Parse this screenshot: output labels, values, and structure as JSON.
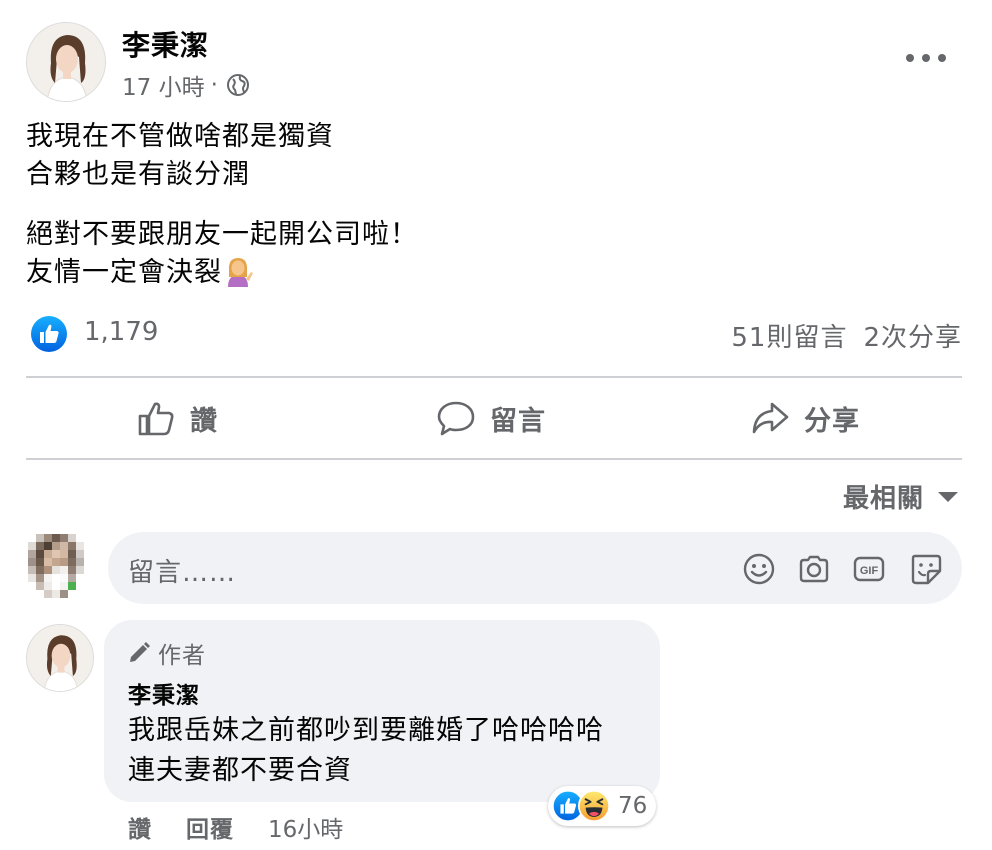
{
  "post": {
    "author": "李秉潔",
    "time": "17 小時",
    "separator": "·",
    "visibility_icon": "globe-icon",
    "paragraphs": [
      [
        "我現在不管做啥都是獨資",
        "合夥也是有談分潤"
      ],
      [
        "絕對不要跟朋友一起開公司啦！",
        "友情一定會決裂"
      ]
    ],
    "emoji": "woman-tipping-hand-emoji"
  },
  "stats": {
    "reaction_icon": "like-badge-icon",
    "likes": "1,179",
    "comments": "51則留言",
    "shares": "2次分享"
  },
  "actions": {
    "like": "讚",
    "comment": "留言",
    "share": "分享"
  },
  "sort": {
    "label": "最相關"
  },
  "composer": {
    "placeholder": "留言……",
    "icons": [
      "emoji-icon",
      "camera-icon",
      "gif-icon",
      "sticker-icon"
    ]
  },
  "comment": {
    "badge": "作者",
    "author": "李秉潔",
    "lines": [
      "我跟岳妹之前都吵到要離婚了哈哈哈哈",
      "連夫妻都不要合資"
    ],
    "reaction_count": "76",
    "like_label": "讚",
    "reply_label": "回覆",
    "time": "16小時"
  },
  "colors": {
    "text_primary": "#050505",
    "text_secondary": "#65676b",
    "facebook_blue": "#1877f2",
    "bubble_bg": "#f0f2f5",
    "divider": "#ced0d4"
  }
}
